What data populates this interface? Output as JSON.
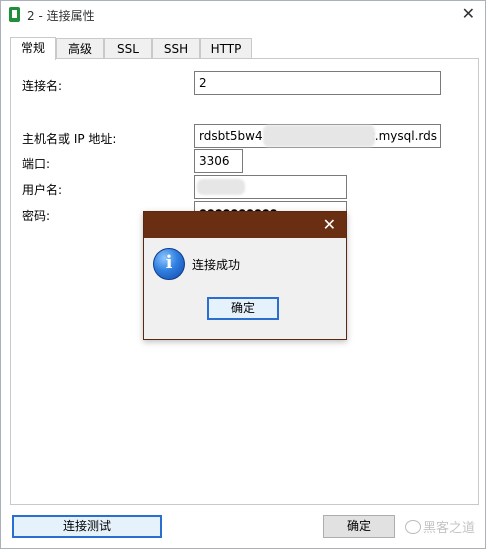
{
  "window": {
    "title": "2 - 连接属性"
  },
  "tabs": [
    {
      "label": "常规",
      "active": true
    },
    {
      "label": "高级",
      "active": false
    },
    {
      "label": "SSL",
      "active": false
    },
    {
      "label": "SSH",
      "active": false
    },
    {
      "label": "HTTP",
      "active": false
    }
  ],
  "form": {
    "connection_name_label": "连接名:",
    "connection_name_value": "2",
    "host_label": "主机名或 IP 地址:",
    "host_value_start": "rdsbt5bw4",
    "host_value_end": "c.mysql.rds",
    "port_label": "端口:",
    "port_value": "3306",
    "user_label": "用户名:",
    "password_label": "密码:",
    "password_value": "●●●●●●●●●●"
  },
  "dialog": {
    "message": "连接成功",
    "ok_label": "确定",
    "icon": "info-icon"
  },
  "footer": {
    "test_button": "连接测试",
    "ok_button": "确定",
    "watermark": "黑客之道"
  },
  "colors": {
    "dialog_titlebar": "#6a2f12",
    "focus_border": "#2a6fcf"
  }
}
